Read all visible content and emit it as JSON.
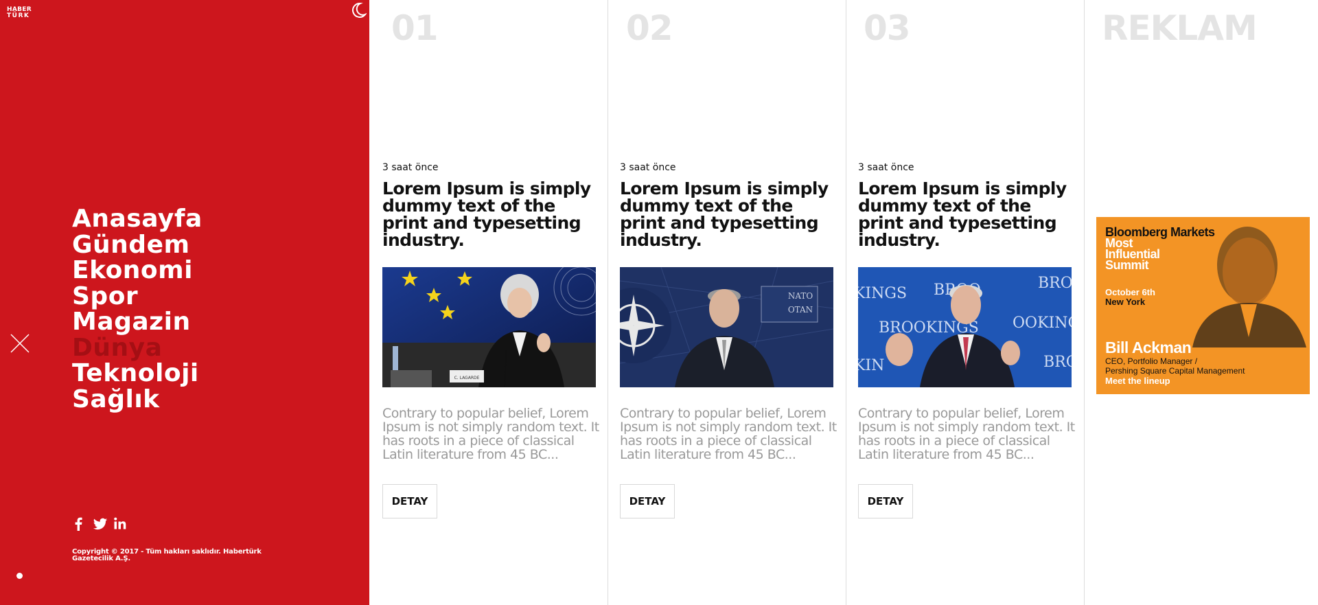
{
  "brand": {
    "logo_line1": "HABER",
    "logo_line2": "TÜRK",
    "accent": "#cd161d",
    "active_nav_color": "#a40f14"
  },
  "sidebar": {
    "nav": [
      "Anasayfa",
      "Gündem",
      "Ekonomi",
      "Spor",
      "Magazin",
      "Dünya",
      "Teknoloji",
      "Sağlık"
    ],
    "active_item": "Dünya",
    "social_icons": [
      "facebook-icon",
      "twitter-icon",
      "linkedin-icon"
    ],
    "copyright": "Copyright © 2017 - Tüm hakları saklıdır. Habertürk Gazetecilik A.Ş."
  },
  "columns": [
    {
      "number": "01",
      "time": "3 saat önce",
      "headline": "Lorem Ipsum is simply dummy text of the print and typesetting industry.",
      "excerpt": "Contrary to popular belief, Lorem Ipsum is not simply random text. It has roots in a piece of classical Latin literature from 45 BC...",
      "button": "DETAY",
      "photo_caption": "C. LAGARDE"
    },
    {
      "number": "02",
      "time": "3 saat önce",
      "headline": "Lorem Ipsum is simply dummy text of the print and typesetting industry.",
      "excerpt": "Contrary to popular belief, Lorem Ipsum is not simply random text. It has roots in a piece of classical Latin literature from 45 BC...",
      "button": "DETAY",
      "photo_sign_1": "NATO",
      "photo_sign_2": "OTAN"
    },
    {
      "number": "03",
      "time": "3 saat önce",
      "headline": "Lorem Ipsum is simply dummy text of the print and typesetting industry.",
      "excerpt": "Contrary to popular belief, Lorem Ipsum is not simply random text. It has roots in a piece of classical Latin literature from 45 BC...",
      "button": "DETAY",
      "photo_backdrop": [
        "KINGS",
        "BROO",
        "BRO",
        "BROOKINGS",
        "OOKINGS",
        "KIN",
        "BRO"
      ]
    }
  ],
  "ad": {
    "label": "REKLAM",
    "title": "Bloomberg Markets",
    "subtitle_1": "Most",
    "subtitle_2": "Influential",
    "subtitle_3": "Summit",
    "date": "October 6th",
    "location": "New York",
    "person": "Bill Ackman",
    "role_1": "CEO, Portfolio Manager /",
    "role_2": "Pershing Square Capital Management",
    "cta": "Meet the lineup"
  }
}
